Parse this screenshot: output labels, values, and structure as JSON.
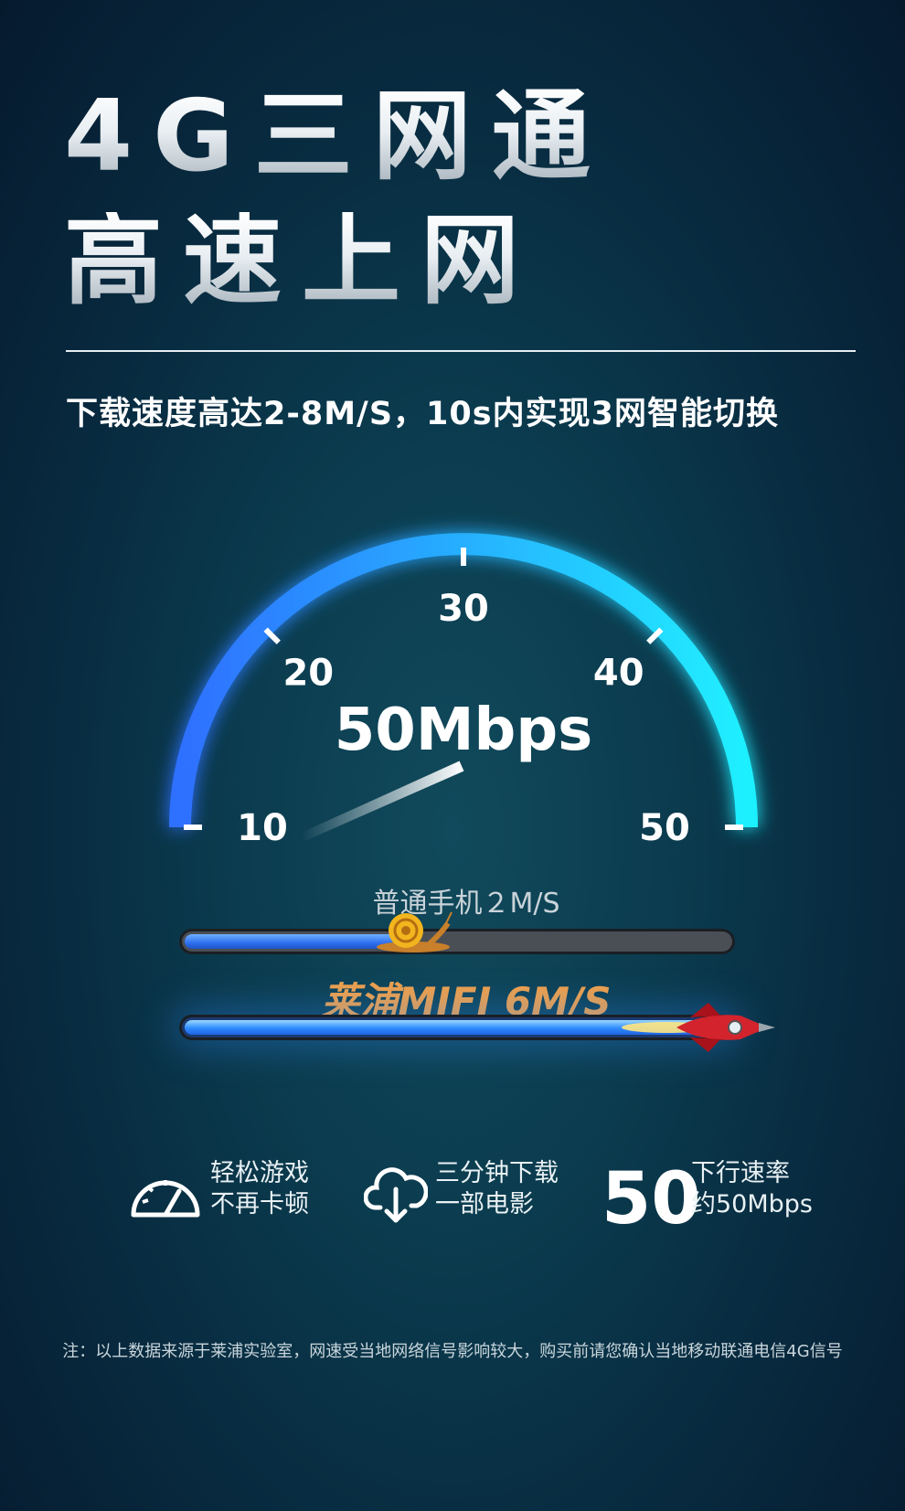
{
  "headline": {
    "line1": "4G三网通",
    "line2": "高速上网",
    "subtitle": "下载速度高达2-8M/S，10s内实现3网智能切换"
  },
  "gauge": {
    "ticks": [
      "10",
      "20",
      "30",
      "40",
      "50"
    ],
    "readout": "50Mbps",
    "needle_value": 50,
    "arc_colors": [
      "#2f6fff",
      "#1ff0ff"
    ]
  },
  "comparison": {
    "normal": {
      "label": "普通手机２M/S",
      "fill_fraction": 0.42,
      "icon": "snail-icon"
    },
    "mifi": {
      "label": "莱浦MIFI 6M/S",
      "fill_fraction": 1.0,
      "icon": "rocket-icon"
    }
  },
  "features": [
    {
      "icon": "speedometer-icon",
      "line1": "轻松游戏",
      "line2": "不再卡顿"
    },
    {
      "icon": "cloud-download-icon",
      "line1": "三分钟下载",
      "line2": "一部电影"
    },
    {
      "big": "50",
      "line1": "下行速率",
      "line2": "约50Mbps"
    }
  ],
  "footnote": "注：以上数据来源于莱浦实验室，网速受当地网络信号影响较大，购买前请您确认当地移动联通电信4G信号"
}
